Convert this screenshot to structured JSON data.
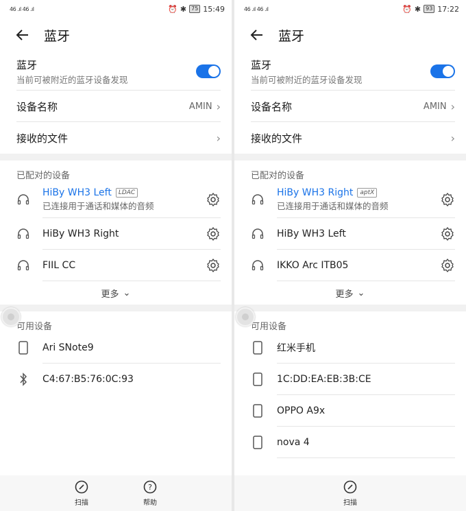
{
  "left": {
    "status": {
      "signal": "46 .ıl 46 .ıl",
      "battery": "75",
      "time": "15:49"
    },
    "title": "蓝牙",
    "bluetooth": {
      "label": "蓝牙",
      "sub": "当前可被附近的蓝牙设备发现"
    },
    "device_name": {
      "label": "设备名称",
      "value": "AMIN"
    },
    "received_files": {
      "label": "接收的文件"
    },
    "paired_header": "已配对的设备",
    "paired": [
      {
        "name": "HiBy WH3 Left",
        "codec": "LDAC",
        "sub": "已连接用于通话和媒体的音频"
      },
      {
        "name": "HiBy WH3 Right"
      },
      {
        "name": "FIIL CC"
      }
    ],
    "more": "更多",
    "available_header": "可用设备",
    "available": [
      {
        "name": "Ari SNote9",
        "icon": "phone-icon"
      },
      {
        "name": "C4:67:B5:76:0C:93",
        "icon": "bluetooth-icon"
      }
    ],
    "bottom": {
      "scan": "扫描",
      "help": "帮助"
    }
  },
  "right": {
    "status": {
      "signal": "46 .ıl 46 .ıl",
      "battery": "93",
      "time": "17:22"
    },
    "title": "蓝牙",
    "bluetooth": {
      "label": "蓝牙",
      "sub": "当前可被附近的蓝牙设备发现"
    },
    "device_name": {
      "label": "设备名称",
      "value": "AMIN"
    },
    "received_files": {
      "label": "接收的文件"
    },
    "paired_header": "已配对的设备",
    "paired": [
      {
        "name": "HiBy WH3 Right",
        "codec": "aptX",
        "sub": "已连接用于通话和媒体的音频"
      },
      {
        "name": "HiBy WH3 Left"
      },
      {
        "name": "IKKO Arc ITB05"
      }
    ],
    "more": "更多",
    "available_header": "可用设备",
    "available": [
      {
        "name": "红米手机",
        "icon": "phone-icon"
      },
      {
        "name": "1C:DD:EA:EB:3B:CE",
        "icon": "phone-icon"
      },
      {
        "name": "OPPO A9x",
        "icon": "phone-icon"
      },
      {
        "name": "nova 4",
        "icon": "phone-icon"
      }
    ],
    "bottom": {
      "scan": "扫描"
    }
  },
  "colors": {
    "accent": "#1a73e8"
  }
}
